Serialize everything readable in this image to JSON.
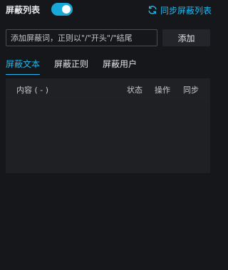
{
  "header": {
    "title": "屏蔽列表",
    "toggle_on": true,
    "sync_label": "同步屏蔽列表",
    "sync_icon": "sync-icon"
  },
  "input": {
    "placeholder": "添加屏蔽词，正则以\"/\"开头\"/\"结尾",
    "value": ""
  },
  "add_button": {
    "label": "添加"
  },
  "tabs": [
    {
      "label": "屏蔽文本",
      "active": true
    },
    {
      "label": "屏蔽正则",
      "active": false
    },
    {
      "label": "屏蔽用户",
      "active": false
    }
  ],
  "table": {
    "columns": [
      "内容 ( - )",
      "状态",
      "操作",
      "同步"
    ],
    "rows": []
  },
  "colors": {
    "accent": "#27b6ea",
    "toggle": "#17a9d8",
    "background": "#16171b",
    "panel": "#1e2024"
  }
}
